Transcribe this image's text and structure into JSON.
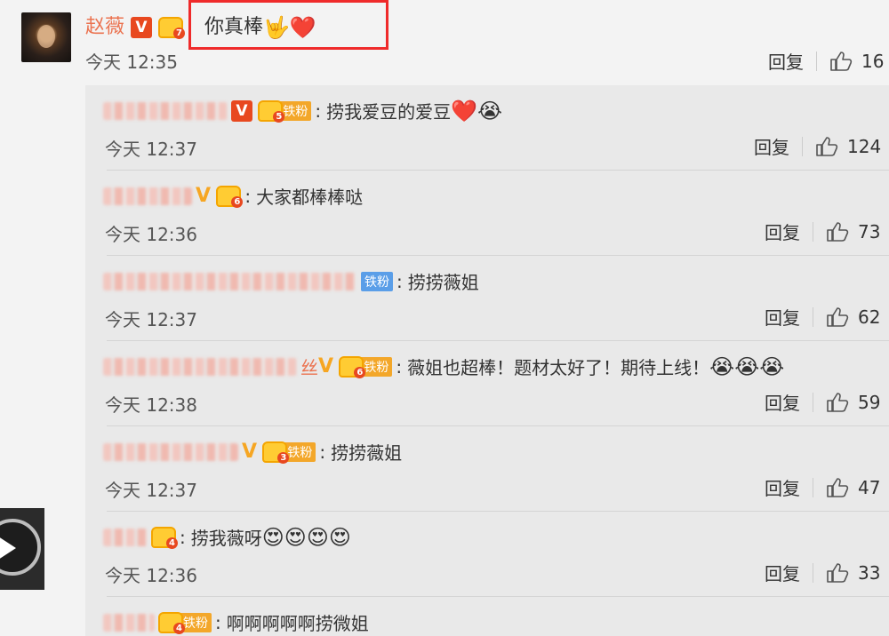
{
  "main_comment": {
    "author": "赵薇",
    "badge_v": "V",
    "level": "7",
    "text": "你真棒",
    "emojis": [
      "🤟",
      "❤️"
    ],
    "time": "今天 12:35",
    "reply_label": "回复",
    "like_count": "16"
  },
  "replies": [
    {
      "level": "5",
      "fan_label": "铁粉",
      "text": "捞我爱豆的爱豆",
      "emojis": [
        "❤️",
        "😭"
      ],
      "time": "今天 12:37",
      "reply_label": "回复",
      "like_count": "124"
    },
    {
      "level": "6",
      "fan_label": "",
      "text": "大家都棒棒哒",
      "emojis": [],
      "time": "今天 12:36",
      "reply_label": "回复",
      "like_count": "73"
    },
    {
      "level": "",
      "fan_label": "铁粉",
      "text": "捞捞薇姐",
      "emojis": [],
      "time": "今天 12:37",
      "reply_label": "回复",
      "like_count": "62"
    },
    {
      "name_tail": "丝",
      "level": "6",
      "fan_label": "铁粉",
      "text": "薇姐也超棒！题材太好了！期待上线！",
      "emojis": [
        "😭",
        "😭",
        "😭"
      ],
      "time": "今天 12:38",
      "reply_label": "回复",
      "like_count": "59"
    },
    {
      "level": "3",
      "fan_label": "铁粉",
      "text": "捞捞薇姐",
      "emojis": [],
      "time": "今天 12:37",
      "reply_label": "回复",
      "like_count": "47"
    },
    {
      "level": "4",
      "fan_label": "",
      "text": "捞我薇呀",
      "emojis": [
        "😍",
        "😍",
        "😍",
        "😍"
      ],
      "time": "今天 12:36",
      "reply_label": "回复",
      "like_count": "33"
    },
    {
      "level": "4",
      "fan_label": "铁粉",
      "text": "啊啊啊啊啊捞微姐",
      "emojis": [],
      "time": "",
      "reply_label": "",
      "like_count": ""
    }
  ],
  "colors": {
    "name_accent": "#eb7350",
    "highlight_box": "#ef2a2a",
    "badge_orange": "#f6a623",
    "fan_blue": "#5a9ee8"
  },
  "icons": {
    "like": "thumbs-up-icon",
    "play": "play-icon"
  }
}
